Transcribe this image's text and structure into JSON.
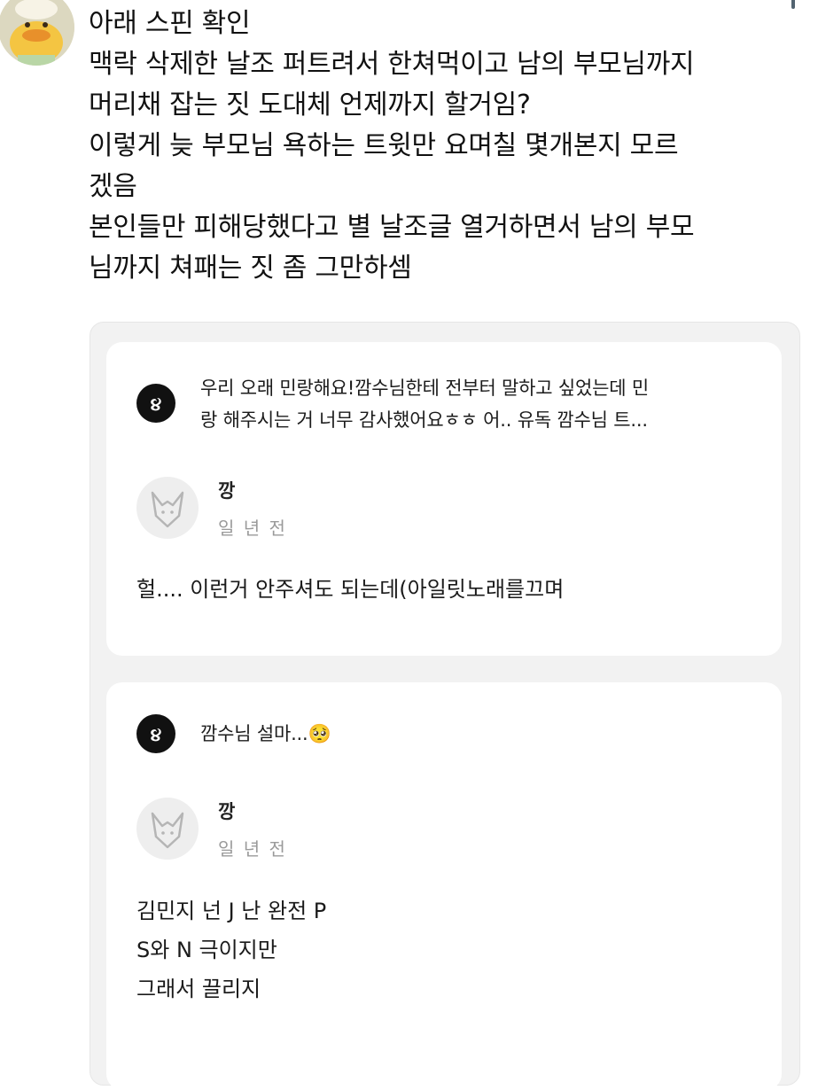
{
  "tweet": {
    "author_avatar_icon": "duck-character-avatar",
    "lines": [
      "아래 스핀 확인",
      "맥락 삭제한 날조 퍼트려서 한쳐먹이고 남의 부모님까지",
      "머리채 잡는 짓 도대체 언제까지 할거임?",
      "이렇게 늦 부모님 욕하는 트윗만 요며칠 몇개본지 모르",
      "겠음",
      "본인들만 피해당했다고 별 날조글 열거하면서 남의 부모",
      "님까지 쳐패는 짓 좀 그만하셈"
    ]
  },
  "cards": [
    {
      "question_icon": "asked-logo-icon",
      "question_lines": [
        "우리 오래 민랑해요!깜수님한테 전부터 말하고 싶었는데 민",
        "랑 해주시는 거 너무 감사했어요ㅎㅎ 어.. 유독 깜수님 트..."
      ],
      "user_avatar_icon": "fox-avatar-icon",
      "user_name": "깡",
      "time": "일 년 전",
      "answer_lines": [
        "헐.... 이런거 안주셔도 되는데(아일릿노래를끄며"
      ]
    },
    {
      "question_icon": "asked-logo-icon",
      "question_lines": [
        "깜수님 설마...🥺"
      ],
      "user_avatar_icon": "fox-avatar-icon",
      "user_name": "깡",
      "time": "일 년 전",
      "answer_lines": [
        "김민지 넌 J 난 완전 P",
        "S와 N 극이지만",
        "그래서 끌리지"
      ]
    }
  ]
}
